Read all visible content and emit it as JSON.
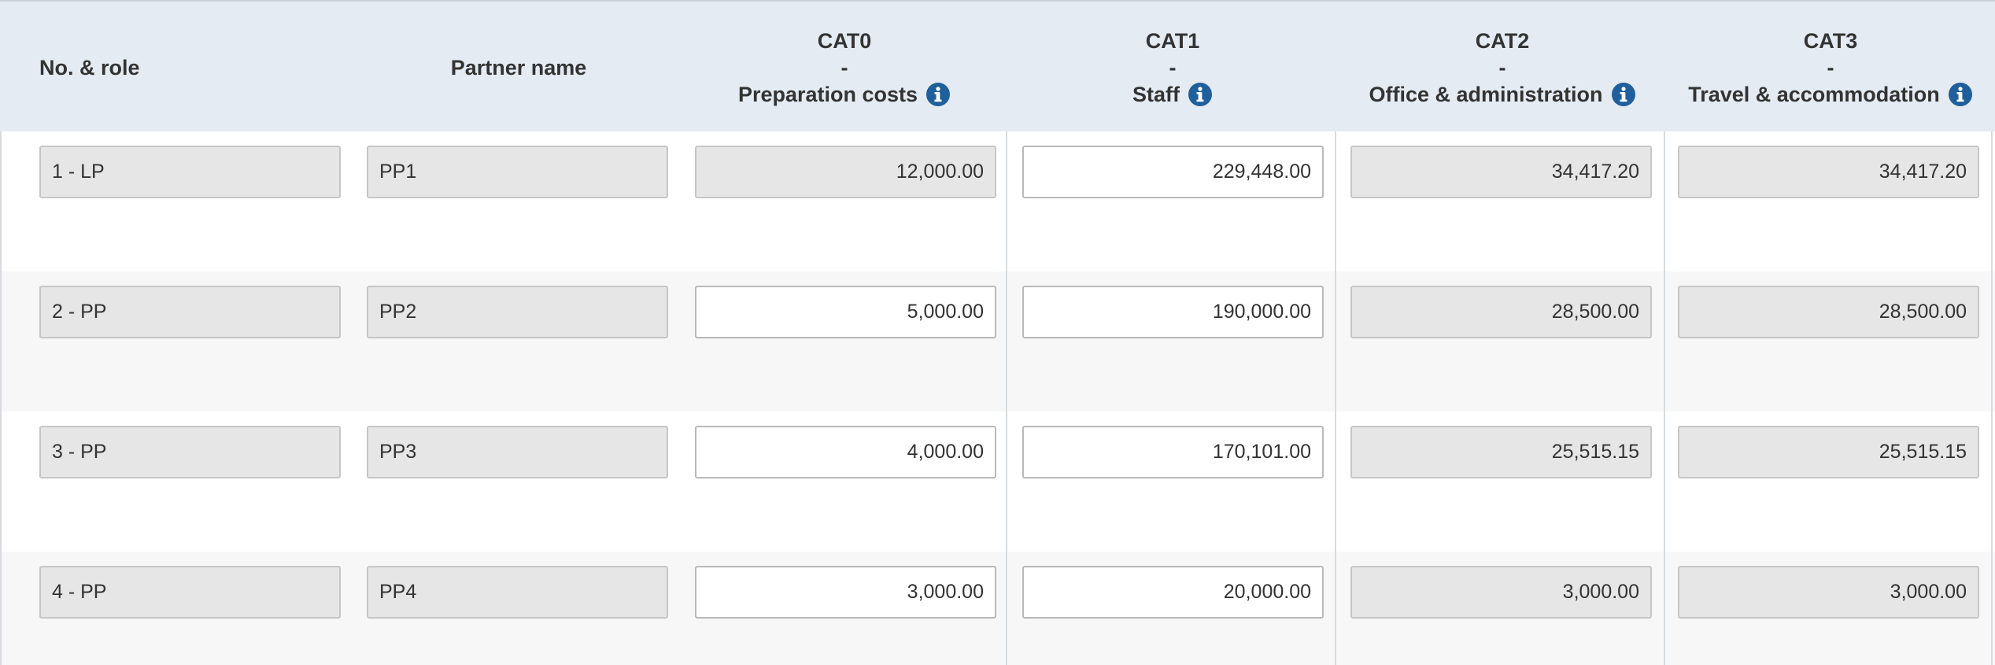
{
  "headers": {
    "col_role": "No. & role",
    "col_partner": "Partner name",
    "cat0": {
      "code": "CAT0",
      "sep": "-",
      "name": "Preparation costs"
    },
    "cat1": {
      "code": "CAT1",
      "sep": "-",
      "name": "Staff"
    },
    "cat2": {
      "code": "CAT2",
      "sep": "-",
      "name": "Office & administration"
    },
    "cat3": {
      "code": "CAT3",
      "sep": "-",
      "name": "Travel & accommodation"
    }
  },
  "rows": [
    {
      "role": "1 - LP",
      "partner": "PP1",
      "cat0": "12,000.00",
      "cat1": "229,448.00",
      "cat2": "34,417.20",
      "cat3": "34,417.20",
      "cat0_editable": false
    },
    {
      "role": "2 - PP",
      "partner": "PP2",
      "cat0": "5,000.00",
      "cat1": "190,000.00",
      "cat2": "28,500.00",
      "cat3": "28,500.00",
      "cat0_editable": true
    },
    {
      "role": "3 - PP",
      "partner": "PP3",
      "cat0": "4,000.00",
      "cat1": "170,101.00",
      "cat2": "25,515.15",
      "cat3": "25,515.15",
      "cat0_editable": true
    },
    {
      "role": "4 - PP",
      "partner": "PP4",
      "cat0": "3,000.00",
      "cat1": "20,000.00",
      "cat2": "3,000.00",
      "cat3": "3,000.00",
      "cat0_editable": true
    }
  ],
  "colors": {
    "header_bg": "#e4ebf3",
    "info_icon": "#1f5f9b",
    "readonly_field_bg": "#e6e6e6",
    "editable_field_bg": "#ffffff"
  },
  "icons": {
    "info": "info-circle-icon"
  }
}
